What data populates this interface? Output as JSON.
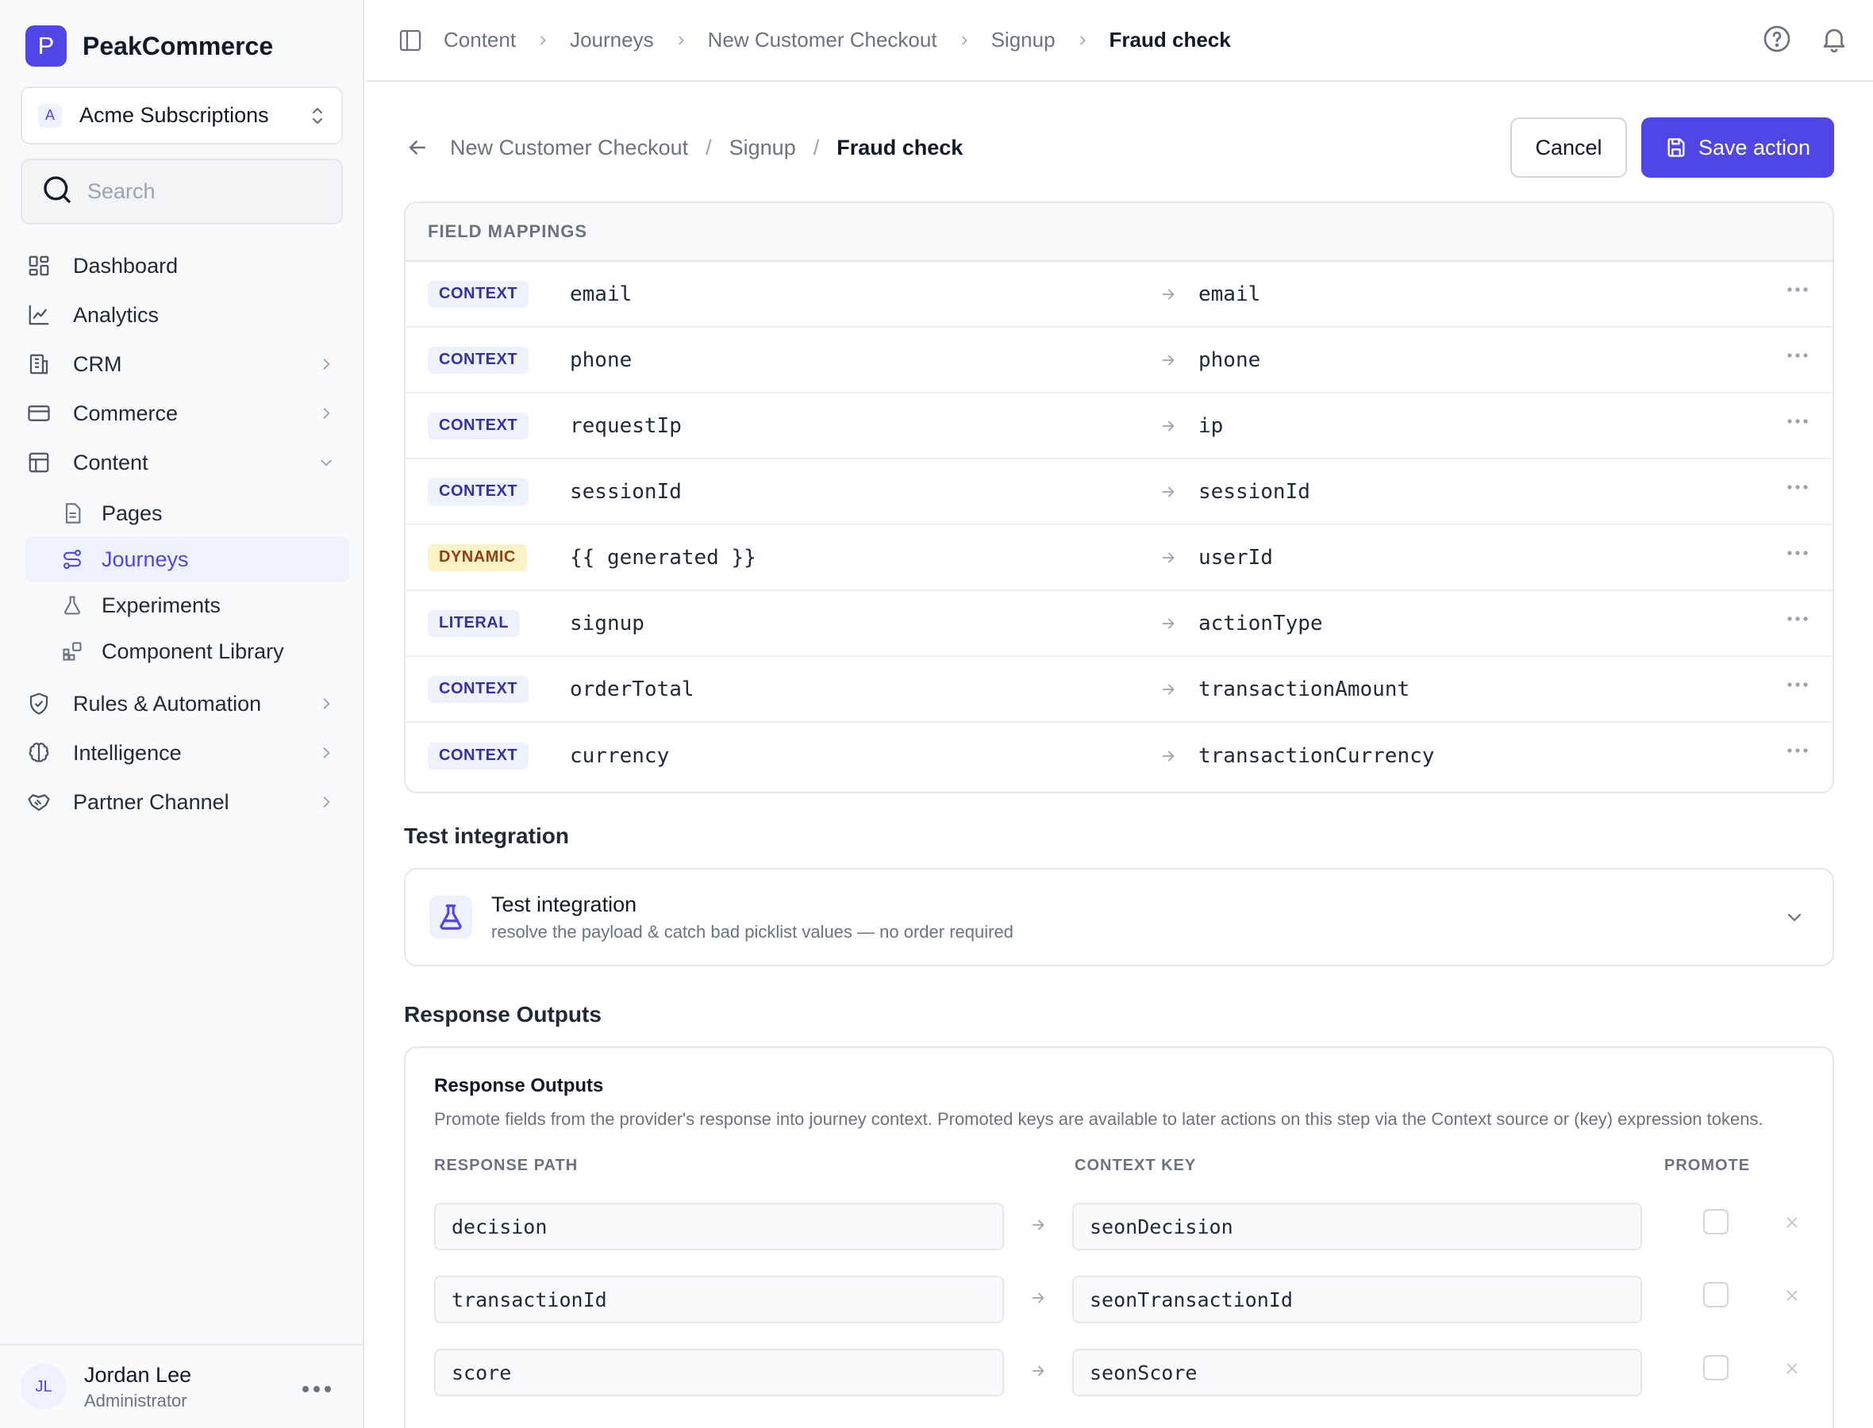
{
  "brand": {
    "logo_letter": "P",
    "name": "PeakCommerce",
    "accent": "#4f46e5"
  },
  "workspace": {
    "badge": "A",
    "name": "Acme Subscriptions"
  },
  "search": {
    "placeholder": "Search"
  },
  "nav": {
    "dashboard": "Dashboard",
    "analytics": "Analytics",
    "crm": "CRM",
    "commerce": "Commerce",
    "content": "Content",
    "pages": "Pages",
    "journeys": "Journeys",
    "experiments": "Experiments",
    "component_library": "Component Library",
    "rules": "Rules & Automation",
    "intelligence": "Intelligence",
    "partner": "Partner Channel"
  },
  "user": {
    "initials": "JL",
    "name": "Jordan Lee",
    "role": "Administrator"
  },
  "topbar": {
    "crumbs": [
      "Content",
      "Journeys",
      "New Customer Checkout",
      "Signup",
      "Fraud check"
    ]
  },
  "page": {
    "crumbs": [
      "New Customer Checkout",
      "Signup",
      "Fraud check"
    ],
    "cancel": "Cancel",
    "save": "Save action"
  },
  "mappings": {
    "header": "FIELD MAPPINGS",
    "rows": [
      {
        "type": "CONTEXT",
        "source": "email",
        "target": "email"
      },
      {
        "type": "CONTEXT",
        "source": "phone",
        "target": "phone"
      },
      {
        "type": "CONTEXT",
        "source": "requestIp",
        "target": "ip"
      },
      {
        "type": "CONTEXT",
        "source": "sessionId",
        "target": "sessionId"
      },
      {
        "type": "DYNAMIC",
        "source": "{{ generated }}",
        "target": "userId"
      },
      {
        "type": "LITERAL",
        "source": "signup",
        "target": "actionType"
      },
      {
        "type": "CONTEXT",
        "source": "orderTotal",
        "target": "transactionAmount"
      },
      {
        "type": "CONTEXT",
        "source": "currency",
        "target": "transactionCurrency"
      }
    ]
  },
  "test": {
    "section_title": "Test integration",
    "title": "Test integration",
    "subtitle": "resolve the payload & catch bad picklist values — no order required"
  },
  "outputs": {
    "section_title": "Response Outputs",
    "title": "Response Outputs",
    "description": "Promote fields from the provider's response into journey context. Promoted keys are available to later actions on this step via the Context source or (key) expression tokens.",
    "col_path": "RESPONSE PATH",
    "col_key": "CONTEXT KEY",
    "col_promote": "PROMOTE",
    "rows": [
      {
        "path": "decision",
        "key": "seonDecision",
        "promote": false
      },
      {
        "path": "transactionId",
        "key": "seonTransactionId",
        "promote": false
      },
      {
        "path": "score",
        "key": "seonScore",
        "promote": false
      }
    ]
  }
}
